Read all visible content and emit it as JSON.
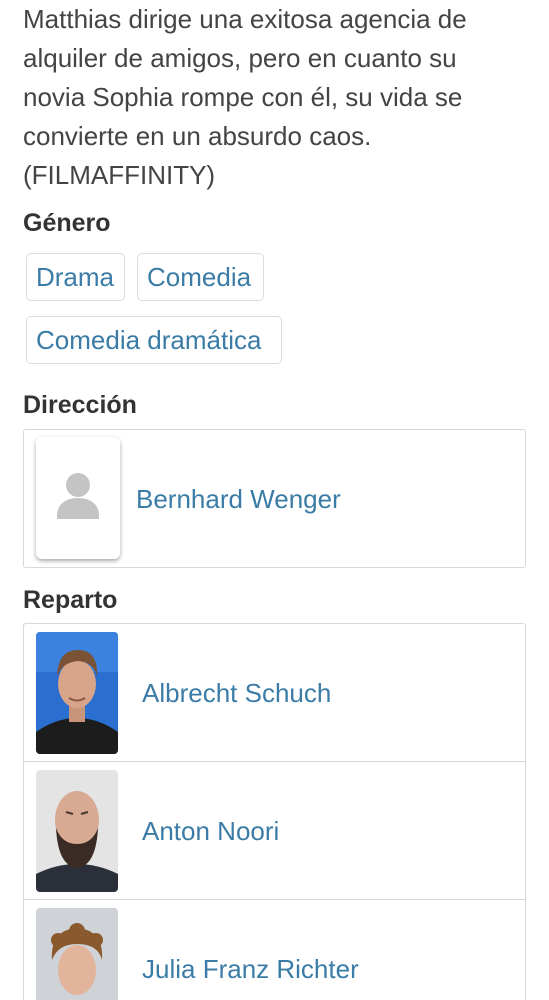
{
  "synopsis": "Matthias dirige una exitosa agencia de\nalquiler de amigos, pero en cuanto su\nnovia Sophia rompe con él, su vida se\nconvierte en un absurdo caos.\n(FILMAFFINITY)",
  "genre": {
    "title": "Género",
    "tags": [
      "Drama",
      "Comedia",
      "Comedia dramática"
    ]
  },
  "direction": {
    "title": "Dirección",
    "people": [
      {
        "name": "Bernhard Wenger",
        "icon": "person-placeholder-icon"
      }
    ]
  },
  "cast": {
    "title": "Reparto",
    "people": [
      {
        "name": "Albrecht Schuch"
      },
      {
        "name": "Anton Noori"
      },
      {
        "name": "Julia Franz Richter"
      }
    ]
  },
  "colors": {
    "link": "#3b7ca6",
    "border": "#d8d8d8",
    "text": "#333333"
  }
}
